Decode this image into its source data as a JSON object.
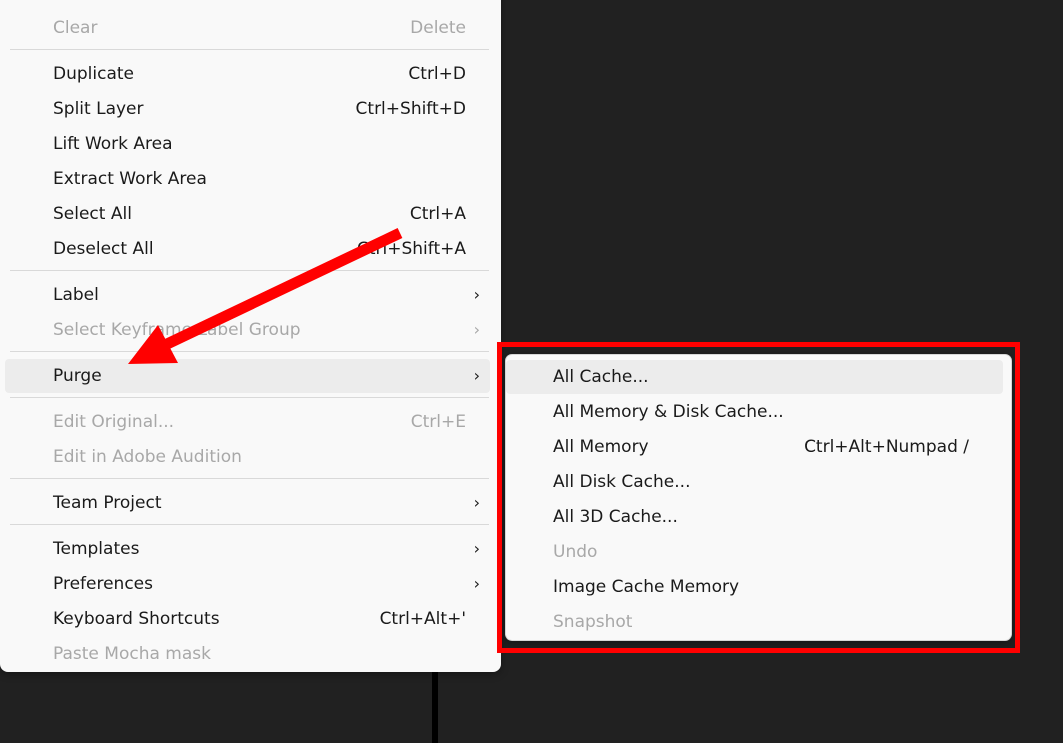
{
  "main_menu": {
    "clear": {
      "label": "Clear",
      "shortcut": "Delete"
    },
    "duplicate": {
      "label": "Duplicate",
      "shortcut": "Ctrl+D"
    },
    "split_layer": {
      "label": "Split Layer",
      "shortcut": "Ctrl+Shift+D"
    },
    "lift_work_area": {
      "label": "Lift Work Area"
    },
    "extract_work_area": {
      "label": "Extract Work Area"
    },
    "select_all": {
      "label": "Select All",
      "shortcut": "Ctrl+A"
    },
    "deselect_all": {
      "label": "Deselect All",
      "shortcut": "Ctrl+Shift+A"
    },
    "label": {
      "label": "Label",
      "chevron": "›"
    },
    "select_keyframe_label_group": {
      "label": "Select Keyframe Label Group",
      "chevron": "›"
    },
    "purge": {
      "label": "Purge",
      "chevron": "›"
    },
    "edit_original": {
      "label": "Edit Original...",
      "shortcut": "Ctrl+E"
    },
    "edit_in_audition": {
      "label": "Edit in Adobe Audition"
    },
    "team_project": {
      "label": "Team Project",
      "chevron": "›"
    },
    "templates": {
      "label": "Templates",
      "chevron": "›"
    },
    "preferences": {
      "label": "Preferences",
      "chevron": "›"
    },
    "keyboard_shortcuts": {
      "label": "Keyboard Shortcuts",
      "shortcut": "Ctrl+Alt+'"
    },
    "paste_mocha_mask": {
      "label": "Paste Mocha mask"
    }
  },
  "purge_submenu": {
    "all_cache": {
      "label": "All Cache..."
    },
    "all_memory_disk_cache": {
      "label": "All Memory & Disk Cache..."
    },
    "all_memory": {
      "label": "All Memory",
      "shortcut": "Ctrl+Alt+Numpad /"
    },
    "all_disk_cache": {
      "label": "All Disk Cache..."
    },
    "all_3d_cache": {
      "label": "All 3D Cache..."
    },
    "undo": {
      "label": "Undo"
    },
    "image_cache_memory": {
      "label": "Image Cache Memory"
    },
    "snapshot": {
      "label": "Snapshot"
    }
  },
  "colors": {
    "background": "#212121",
    "menu_background": "#f9f9f9",
    "annotation_red": "#ff0000",
    "disabled_text": "#a8a8a8"
  }
}
